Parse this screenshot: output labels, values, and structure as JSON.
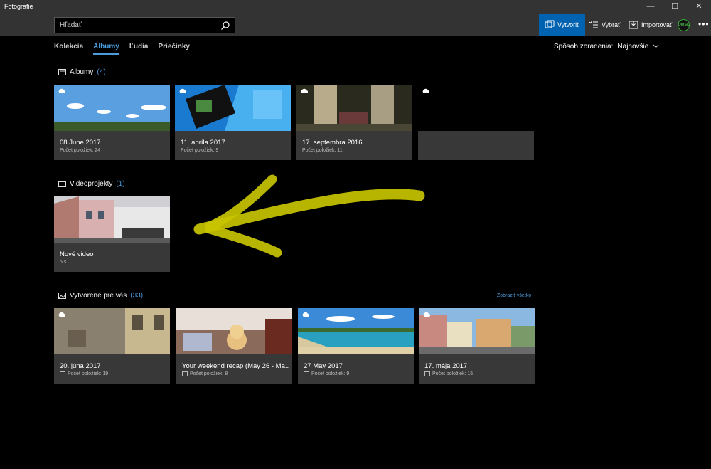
{
  "window": {
    "title": "Fotografie",
    "minimize": "—",
    "maximize": "☐",
    "close": "✕"
  },
  "search": {
    "placeholder": "Hľadať"
  },
  "toolbar": {
    "create_label": "Vytvoriť",
    "select_label": "Vybrať",
    "import_label": "Importovať",
    "avatar_text": "DWSC",
    "more_label": "•••"
  },
  "tabs": [
    {
      "label": "Kolekcia"
    },
    {
      "label": "Albumy"
    },
    {
      "label": "Ľudia"
    },
    {
      "label": "Priečinky"
    }
  ],
  "active_tab": "Albumy",
  "sort": {
    "label": "Spôsob zoradenia:",
    "value": "Najnovšie"
  },
  "albums_section": {
    "title": "Albumy",
    "count": "(4)",
    "items": [
      {
        "title": "08 June 2017",
        "subtitle": "Počet položiek: 24"
      },
      {
        "title": "11. apríla 2017",
        "subtitle": "Počet položiek: 9"
      },
      {
        "title": "17. septembra 2016",
        "subtitle": "Počet položiek: 11"
      },
      {
        "title": "",
        "subtitle": ""
      }
    ]
  },
  "video_section": {
    "title": "Videoprojekty",
    "count": "(1)",
    "items": [
      {
        "title": "Nové video",
        "subtitle": "5 s"
      }
    ]
  },
  "created_section": {
    "title": "Vytvorené pre vás",
    "count": "(33)",
    "see_all": "Zobraziť všetko",
    "items": [
      {
        "title": "20. júna 2017",
        "subtitle": "Počet položiek: 19"
      },
      {
        "title": "Your weekend recap (May 26 - Ma...",
        "subtitle": "Počet položiek: 8"
      },
      {
        "title": "27 May 2017",
        "subtitle": "Počet položiek: 9"
      },
      {
        "title": "17. mája 2017",
        "subtitle": "Počet položiek: 15"
      }
    ]
  },
  "colors": {
    "accent": "#4a9bdc",
    "primary_button": "#0063b1",
    "annotation": "#c8c400"
  }
}
